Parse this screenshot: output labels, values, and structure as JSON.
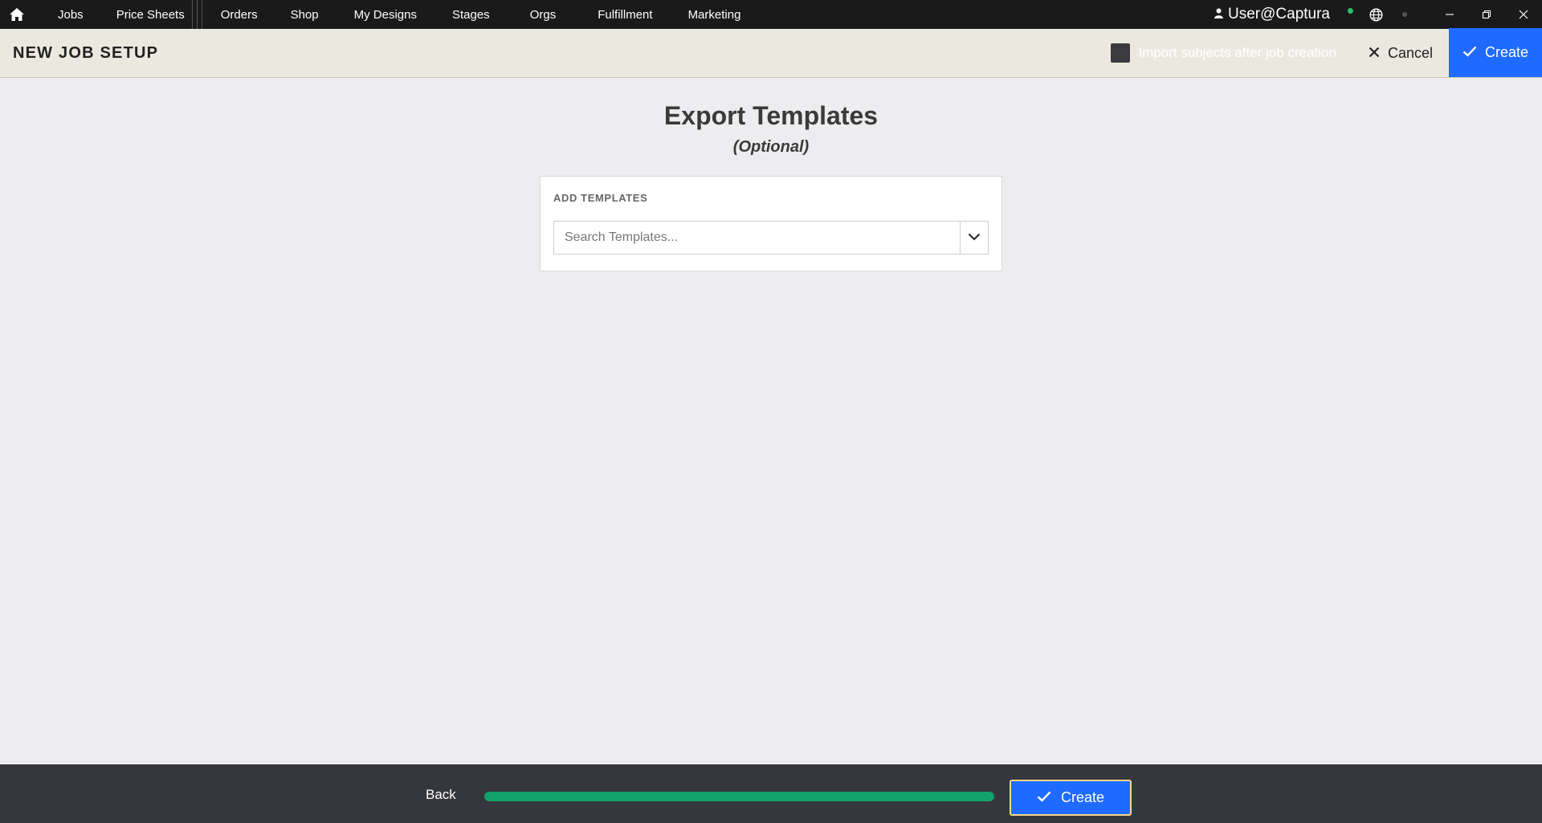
{
  "topbar": {
    "nav_items": [
      "Jobs",
      "Price Sheets",
      "Orders",
      "Shop",
      "My Designs",
      "Stages",
      "Orgs",
      "Fulfillment",
      "Marketing"
    ],
    "user": "User@Captura",
    "status_color": "#22c55e"
  },
  "header": {
    "title": "NEW JOB SETUP",
    "import_label": "Import subjects after job creation",
    "import_checked": false,
    "cancel_label": "Cancel",
    "create_label": "Create"
  },
  "main": {
    "title": "Export Templates",
    "subtitle": "(Optional)",
    "panel_label": "ADD TEMPLATES",
    "search_placeholder": "Search Templates...",
    "search_value": ""
  },
  "footer": {
    "back_label": "Back",
    "progress": 1.0,
    "create_label": "Create"
  },
  "colors": {
    "accent": "#1f6bff",
    "progress": "#11a36a",
    "topbar": "#1a1a1a",
    "header_bg": "#ebe9df",
    "footer_bg": "#36373d"
  }
}
